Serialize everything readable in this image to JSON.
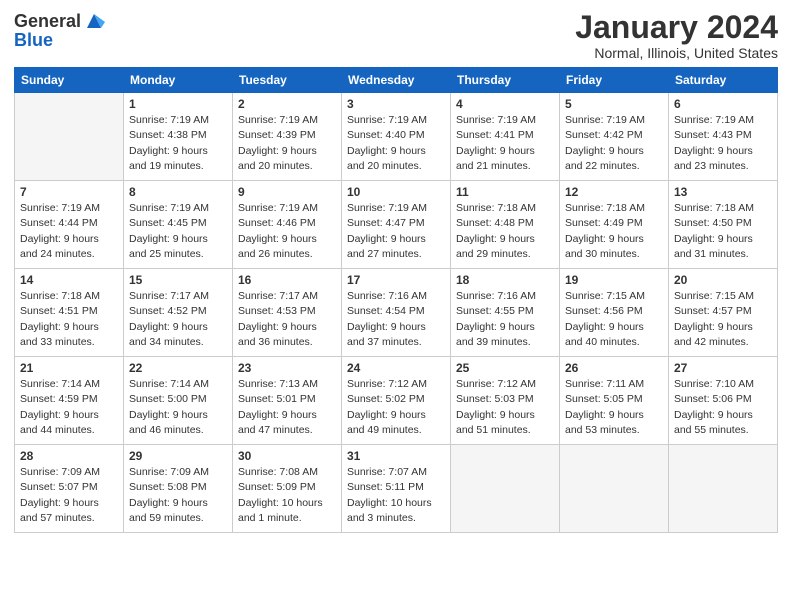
{
  "header": {
    "logo_line1": "General",
    "logo_line2": "Blue",
    "month_title": "January 2024",
    "location": "Normal, Illinois, United States"
  },
  "days_of_week": [
    "Sunday",
    "Monday",
    "Tuesday",
    "Wednesday",
    "Thursday",
    "Friday",
    "Saturday"
  ],
  "weeks": [
    [
      {
        "day": "",
        "info": ""
      },
      {
        "day": "1",
        "info": "Sunrise: 7:19 AM\nSunset: 4:38 PM\nDaylight: 9 hours\nand 19 minutes."
      },
      {
        "day": "2",
        "info": "Sunrise: 7:19 AM\nSunset: 4:39 PM\nDaylight: 9 hours\nand 20 minutes."
      },
      {
        "day": "3",
        "info": "Sunrise: 7:19 AM\nSunset: 4:40 PM\nDaylight: 9 hours\nand 20 minutes."
      },
      {
        "day": "4",
        "info": "Sunrise: 7:19 AM\nSunset: 4:41 PM\nDaylight: 9 hours\nand 21 minutes."
      },
      {
        "day": "5",
        "info": "Sunrise: 7:19 AM\nSunset: 4:42 PM\nDaylight: 9 hours\nand 22 minutes."
      },
      {
        "day": "6",
        "info": "Sunrise: 7:19 AM\nSunset: 4:43 PM\nDaylight: 9 hours\nand 23 minutes."
      }
    ],
    [
      {
        "day": "7",
        "info": "Sunrise: 7:19 AM\nSunset: 4:44 PM\nDaylight: 9 hours\nand 24 minutes."
      },
      {
        "day": "8",
        "info": "Sunrise: 7:19 AM\nSunset: 4:45 PM\nDaylight: 9 hours\nand 25 minutes."
      },
      {
        "day": "9",
        "info": "Sunrise: 7:19 AM\nSunset: 4:46 PM\nDaylight: 9 hours\nand 26 minutes."
      },
      {
        "day": "10",
        "info": "Sunrise: 7:19 AM\nSunset: 4:47 PM\nDaylight: 9 hours\nand 27 minutes."
      },
      {
        "day": "11",
        "info": "Sunrise: 7:18 AM\nSunset: 4:48 PM\nDaylight: 9 hours\nand 29 minutes."
      },
      {
        "day": "12",
        "info": "Sunrise: 7:18 AM\nSunset: 4:49 PM\nDaylight: 9 hours\nand 30 minutes."
      },
      {
        "day": "13",
        "info": "Sunrise: 7:18 AM\nSunset: 4:50 PM\nDaylight: 9 hours\nand 31 minutes."
      }
    ],
    [
      {
        "day": "14",
        "info": "Sunrise: 7:18 AM\nSunset: 4:51 PM\nDaylight: 9 hours\nand 33 minutes."
      },
      {
        "day": "15",
        "info": "Sunrise: 7:17 AM\nSunset: 4:52 PM\nDaylight: 9 hours\nand 34 minutes."
      },
      {
        "day": "16",
        "info": "Sunrise: 7:17 AM\nSunset: 4:53 PM\nDaylight: 9 hours\nand 36 minutes."
      },
      {
        "day": "17",
        "info": "Sunrise: 7:16 AM\nSunset: 4:54 PM\nDaylight: 9 hours\nand 37 minutes."
      },
      {
        "day": "18",
        "info": "Sunrise: 7:16 AM\nSunset: 4:55 PM\nDaylight: 9 hours\nand 39 minutes."
      },
      {
        "day": "19",
        "info": "Sunrise: 7:15 AM\nSunset: 4:56 PM\nDaylight: 9 hours\nand 40 minutes."
      },
      {
        "day": "20",
        "info": "Sunrise: 7:15 AM\nSunset: 4:57 PM\nDaylight: 9 hours\nand 42 minutes."
      }
    ],
    [
      {
        "day": "21",
        "info": "Sunrise: 7:14 AM\nSunset: 4:59 PM\nDaylight: 9 hours\nand 44 minutes."
      },
      {
        "day": "22",
        "info": "Sunrise: 7:14 AM\nSunset: 5:00 PM\nDaylight: 9 hours\nand 46 minutes."
      },
      {
        "day": "23",
        "info": "Sunrise: 7:13 AM\nSunset: 5:01 PM\nDaylight: 9 hours\nand 47 minutes."
      },
      {
        "day": "24",
        "info": "Sunrise: 7:12 AM\nSunset: 5:02 PM\nDaylight: 9 hours\nand 49 minutes."
      },
      {
        "day": "25",
        "info": "Sunrise: 7:12 AM\nSunset: 5:03 PM\nDaylight: 9 hours\nand 51 minutes."
      },
      {
        "day": "26",
        "info": "Sunrise: 7:11 AM\nSunset: 5:05 PM\nDaylight: 9 hours\nand 53 minutes."
      },
      {
        "day": "27",
        "info": "Sunrise: 7:10 AM\nSunset: 5:06 PM\nDaylight: 9 hours\nand 55 minutes."
      }
    ],
    [
      {
        "day": "28",
        "info": "Sunrise: 7:09 AM\nSunset: 5:07 PM\nDaylight: 9 hours\nand 57 minutes."
      },
      {
        "day": "29",
        "info": "Sunrise: 7:09 AM\nSunset: 5:08 PM\nDaylight: 9 hours\nand 59 minutes."
      },
      {
        "day": "30",
        "info": "Sunrise: 7:08 AM\nSunset: 5:09 PM\nDaylight: 10 hours\nand 1 minute."
      },
      {
        "day": "31",
        "info": "Sunrise: 7:07 AM\nSunset: 5:11 PM\nDaylight: 10 hours\nand 3 minutes."
      },
      {
        "day": "",
        "info": ""
      },
      {
        "day": "",
        "info": ""
      },
      {
        "day": "",
        "info": ""
      }
    ]
  ]
}
